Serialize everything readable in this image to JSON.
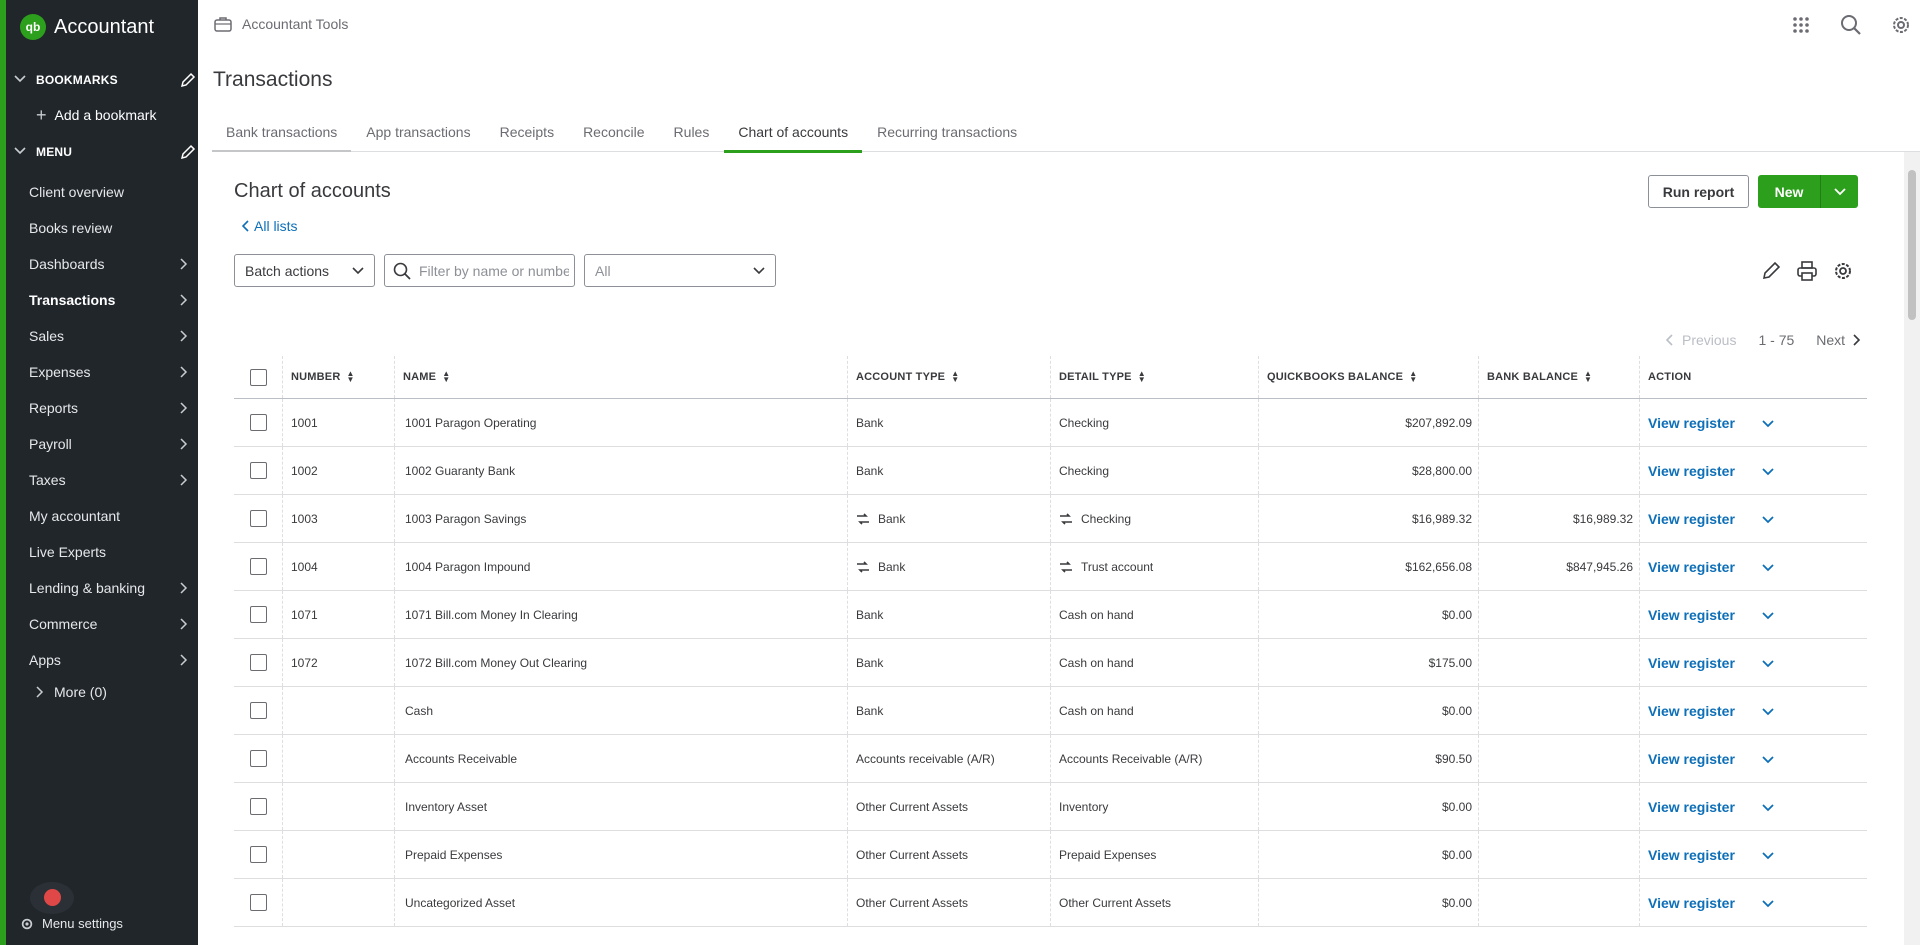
{
  "app": {
    "logo_text": "Accountant",
    "logo_mark": "qb",
    "brand_color": "#2ca01c",
    "link_color": "#0d6fb8"
  },
  "sidebar": {
    "bookmarks_header": "BOOKMARKS",
    "add_bookmark": "Add a bookmark",
    "menu_header": "MENU",
    "items": [
      {
        "label": "Client overview",
        "has_arrow": false
      },
      {
        "label": "Books review",
        "has_arrow": false
      },
      {
        "label": "Dashboards",
        "has_arrow": true
      },
      {
        "label": "Transactions",
        "has_arrow": true,
        "active": true
      },
      {
        "label": "Sales",
        "has_arrow": true
      },
      {
        "label": "Expenses",
        "has_arrow": true
      },
      {
        "label": "Reports",
        "has_arrow": true
      },
      {
        "label": "Payroll",
        "has_arrow": true
      },
      {
        "label": "Taxes",
        "has_arrow": true
      },
      {
        "label": "My accountant",
        "has_arrow": false
      },
      {
        "label": "Live Experts",
        "has_arrow": false
      },
      {
        "label": "Lending & banking",
        "has_arrow": true
      },
      {
        "label": "Commerce",
        "has_arrow": true
      },
      {
        "label": "Apps",
        "has_arrow": true
      }
    ],
    "more": "More (0)",
    "menu_settings": "Menu settings"
  },
  "topbar": {
    "tools_label": "Accountant Tools",
    "icons": [
      "apps-grid-icon",
      "search-icon",
      "gear-icon"
    ]
  },
  "page": {
    "title": "Transactions",
    "tabs": [
      {
        "label": "Bank transactions"
      },
      {
        "label": "App transactions"
      },
      {
        "label": "Receipts"
      },
      {
        "label": "Reconcile"
      },
      {
        "label": "Rules"
      },
      {
        "label": "Chart of accounts",
        "active": true
      },
      {
        "label": "Recurring transactions"
      }
    ]
  },
  "content": {
    "title": "Chart of accounts",
    "all_lists": "All lists",
    "run_report": "Run report",
    "new_label": "New",
    "batch_actions": "Batch actions",
    "filter_placeholder": "Filter by name or number",
    "type_select": "All",
    "pager": {
      "previous": "Previous",
      "range": "1 - 75",
      "next": "Next"
    }
  },
  "table": {
    "headers": {
      "number": "NUMBER",
      "name": "NAME",
      "account_type": "ACCOUNT TYPE",
      "detail_type": "DETAIL TYPE",
      "qb_balance": "QUICKBOOKS BALANCE",
      "bank_balance": "BANK BALANCE",
      "action": "ACTION"
    },
    "action_label": "View register",
    "rows": [
      {
        "number": "1001",
        "name": "1001 Paragon Operating",
        "type": "Bank",
        "detail": "Checking",
        "qb": "$207,892.09",
        "bank": "",
        "linked": false
      },
      {
        "number": "1002",
        "name": "1002 Guaranty Bank",
        "type": "Bank",
        "detail": "Checking",
        "qb": "$28,800.00",
        "bank": "",
        "linked": false
      },
      {
        "number": "1003",
        "name": "1003 Paragon Savings",
        "type": "Bank",
        "detail": "Checking",
        "qb": "$16,989.32",
        "bank": "$16,989.32",
        "linked": true
      },
      {
        "number": "1004",
        "name": "1004 Paragon Impound",
        "type": "Bank",
        "detail": "Trust account",
        "qb": "$162,656.08",
        "bank": "$847,945.26",
        "linked": true
      },
      {
        "number": "1071",
        "name": "1071 Bill.com Money In Clearing",
        "type": "Bank",
        "detail": "Cash on hand",
        "qb": "$0.00",
        "bank": "",
        "linked": false
      },
      {
        "number": "1072",
        "name": "1072 Bill.com Money Out Clearing",
        "type": "Bank",
        "detail": "Cash on hand",
        "qb": "$175.00",
        "bank": "",
        "linked": false
      },
      {
        "number": "",
        "name": "Cash",
        "type": "Bank",
        "detail": "Cash on hand",
        "qb": "$0.00",
        "bank": "",
        "linked": false
      },
      {
        "number": "",
        "name": "Accounts Receivable",
        "type": "Accounts receivable (A/R)",
        "detail": "Accounts Receivable (A/R)",
        "qb": "$90.50",
        "bank": "",
        "linked": false
      },
      {
        "number": "",
        "name": "Inventory Asset",
        "type": "Other Current Assets",
        "detail": "Inventory",
        "qb": "$0.00",
        "bank": "",
        "linked": false
      },
      {
        "number": "",
        "name": "Prepaid Expenses",
        "type": "Other Current Assets",
        "detail": "Prepaid Expenses",
        "qb": "$0.00",
        "bank": "",
        "linked": false
      },
      {
        "number": "",
        "name": "Uncategorized Asset",
        "type": "Other Current Assets",
        "detail": "Other Current Assets",
        "qb": "$0.00",
        "bank": "",
        "linked": false
      }
    ]
  }
}
